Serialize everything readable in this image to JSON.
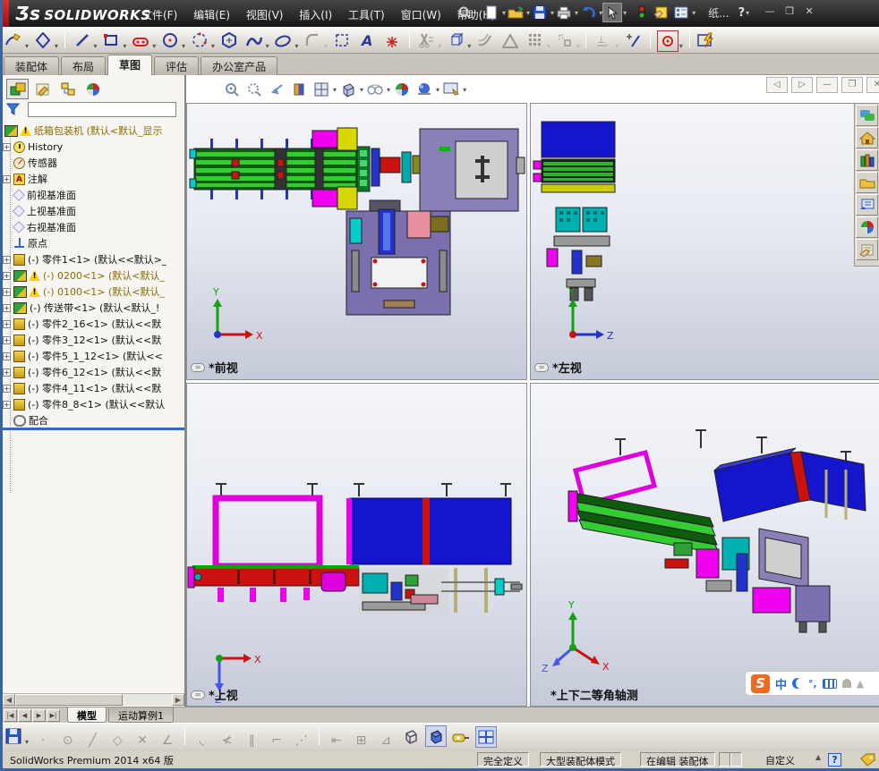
{
  "glyphs": {
    "caret": "▾",
    "chevrons": "»",
    "plus": "+",
    "minimize": "—",
    "restore": "❐",
    "close": "✕",
    "left": "◀",
    "right": "▶",
    "first": "|◀",
    "last": "▶|",
    "up": "▲",
    "help": "?",
    "link": "∞",
    "quest": "?"
  },
  "titlebar": {
    "logo_glyph": "Ʒs",
    "logo_text": "SOLIDWORKS",
    "menus": [
      "文件(F)",
      "编辑(E)",
      "视图(V)",
      "插入(I)",
      "工具(T)",
      "窗口(W)",
      "帮助(H)"
    ],
    "doc_short": "纸...",
    "qat_icons": [
      "search",
      "new-document",
      "open",
      "save",
      "print",
      "undo",
      "select-arrow",
      "rebuild-traffic-light",
      "properties",
      "options-list",
      "help"
    ]
  },
  "sketch_toolbar": {
    "icons": [
      "sketch",
      "smart-dimension",
      "line",
      "rectangle",
      "slot",
      "circle",
      "arc",
      "polygon",
      "spline",
      "ellipse",
      "fillet",
      "mirror-entities",
      "text",
      "point",
      "trim-entities",
      "convert-entities",
      "offset-entities",
      "sketch-alert",
      "linear-pattern",
      "move-entities",
      "display-relations",
      "repair-sketch",
      "quick-snaps",
      "sketch-picture"
    ]
  },
  "command_tabs": [
    {
      "label": "装配体",
      "active": false
    },
    {
      "label": "布局",
      "active": false
    },
    {
      "label": "草图",
      "active": true
    },
    {
      "label": "评估",
      "active": false
    },
    {
      "label": "办公室产品",
      "active": false
    }
  ],
  "panel": {
    "header_icons": [
      "featuremanager-tree",
      "propertymanager",
      "configurationmanager",
      "displaymanager"
    ],
    "tree": [
      {
        "label": "纸箱包装机 (默认<默认_显示",
        "amber": true
      },
      {
        "label": "History"
      },
      {
        "label": "传感器"
      },
      {
        "label": "注解"
      },
      {
        "label": "前视基准面"
      },
      {
        "label": "上视基准面"
      },
      {
        "label": "右视基准面"
      },
      {
        "label": "原点"
      },
      {
        "label": "(-) 零件1<1> (默认<<默认>_"
      },
      {
        "label": "(-) 0200<1> (默认<默认_",
        "amber": true
      },
      {
        "label": "(-) 0100<1> (默认<默认_",
        "amber": true
      },
      {
        "label": "(-) 传送带<1> (默认<默认_!"
      },
      {
        "label": "(-) 零件2_16<1> (默认<<默"
      },
      {
        "label": "(-) 零件3_12<1> (默认<<默"
      },
      {
        "label": "(-) 零件5_1_12<1> (默认<<"
      },
      {
        "label": "(-) 零件6_12<1> (默认<<默"
      },
      {
        "label": "(-) 零件4_11<1> (默认<<默"
      },
      {
        "label": "(-) 零件8_8<1> (默认<<默认"
      },
      {
        "label": "配合"
      }
    ]
  },
  "heads_up": {
    "icons": [
      "zoom-to-fit",
      "zoom-to-area",
      "previous-view",
      "section-view",
      "view-orientation",
      "display-style",
      "hide-show-items",
      "edit-appearance",
      "apply-scene",
      "view-settings"
    ]
  },
  "mdi": {
    "icons": [
      "collapse-featuremanager",
      "expand-featuremanager",
      "minimize-document",
      "restore-document",
      "close-document"
    ]
  },
  "task_pane": {
    "icons": [
      "forum",
      "resources-home",
      "design-library",
      "file-explorer",
      "view-palette",
      "appearances-scenes",
      "custom-properties"
    ]
  },
  "viewports": [
    {
      "label": "*前视",
      "v_axis": "Y",
      "h_axis": "X"
    },
    {
      "label": "*左视",
      "v_axis": "Y",
      "h_axis": "Z"
    },
    {
      "label": "*上视",
      "h_axis": "X",
      "d_axis": "Z"
    },
    {
      "label": "*上下二等角轴测",
      "v_axis": "Y",
      "r_axis": "X",
      "l_axis": "Z"
    }
  ],
  "bottom_tabs": {
    "model": "模型",
    "motion": "运动算例1"
  },
  "bottom_toolbar": {
    "icons": [
      "save",
      "point-snap",
      "concentric-snap",
      "line-snap",
      "polygon-snap",
      "intersection-snap",
      "angle-snap",
      "arc-snap",
      "midpoint-snap",
      "parallel-snap",
      "perpendicular-snap",
      "grid-dots",
      "dimension",
      "grid",
      "angle-measure",
      "wireframe-style",
      "shaded-style",
      "measure",
      "split-viewport"
    ]
  },
  "statusbar": {
    "product": "SolidWorks Premium 2014 x64 版",
    "defined": "完全定义",
    "mode": "大型装配体模式",
    "editing": "在编辑 装配体",
    "custom": "自定义"
  },
  "ime": {
    "logo": "S",
    "lang": "中",
    "punct": "°,",
    "icons": [
      "sogou-logo",
      "chinese-mode",
      "moon",
      "punctuation",
      "soft-keyboard",
      "person",
      "toolbox"
    ]
  },
  "colors": {
    "accent_blue": "#2a6ad4",
    "magenta": "#ee00ee",
    "cad_blue": "#1515cc",
    "cad_red": "#cc1111",
    "cad_green": "#2fa13a",
    "panel_purple": "#8b7fb8"
  }
}
